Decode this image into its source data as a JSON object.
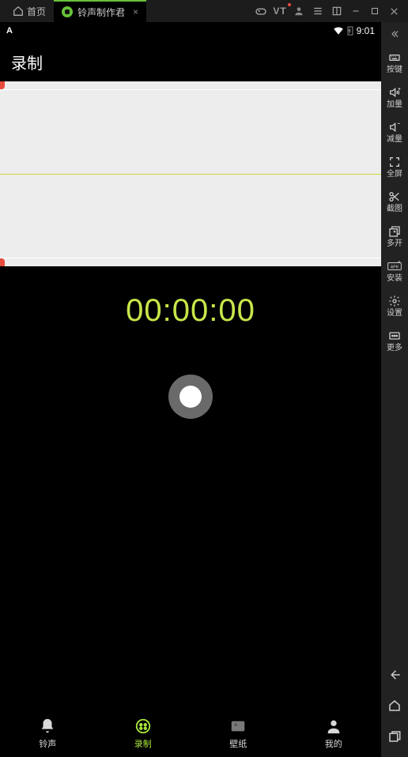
{
  "titlebar": {
    "home_label": "首页",
    "app_tab_label": "铃声制作君"
  },
  "statusbar": {
    "left": "A",
    "time": "9:01"
  },
  "page": {
    "title": "录制"
  },
  "recorder": {
    "timer": "00:00:00"
  },
  "bottom_nav": {
    "items": [
      {
        "label": "铃声",
        "active": false
      },
      {
        "label": "录制",
        "active": true
      },
      {
        "label": "壁纸",
        "active": false
      },
      {
        "label": "我的",
        "active": false
      }
    ]
  },
  "right_rail": {
    "items": [
      {
        "label": "按键"
      },
      {
        "label": "加量"
      },
      {
        "label": "减量"
      },
      {
        "label": "全屏"
      },
      {
        "label": "截图"
      },
      {
        "label": "多开"
      },
      {
        "label": "安装"
      },
      {
        "label": "设置"
      },
      {
        "label": "更多"
      }
    ]
  }
}
